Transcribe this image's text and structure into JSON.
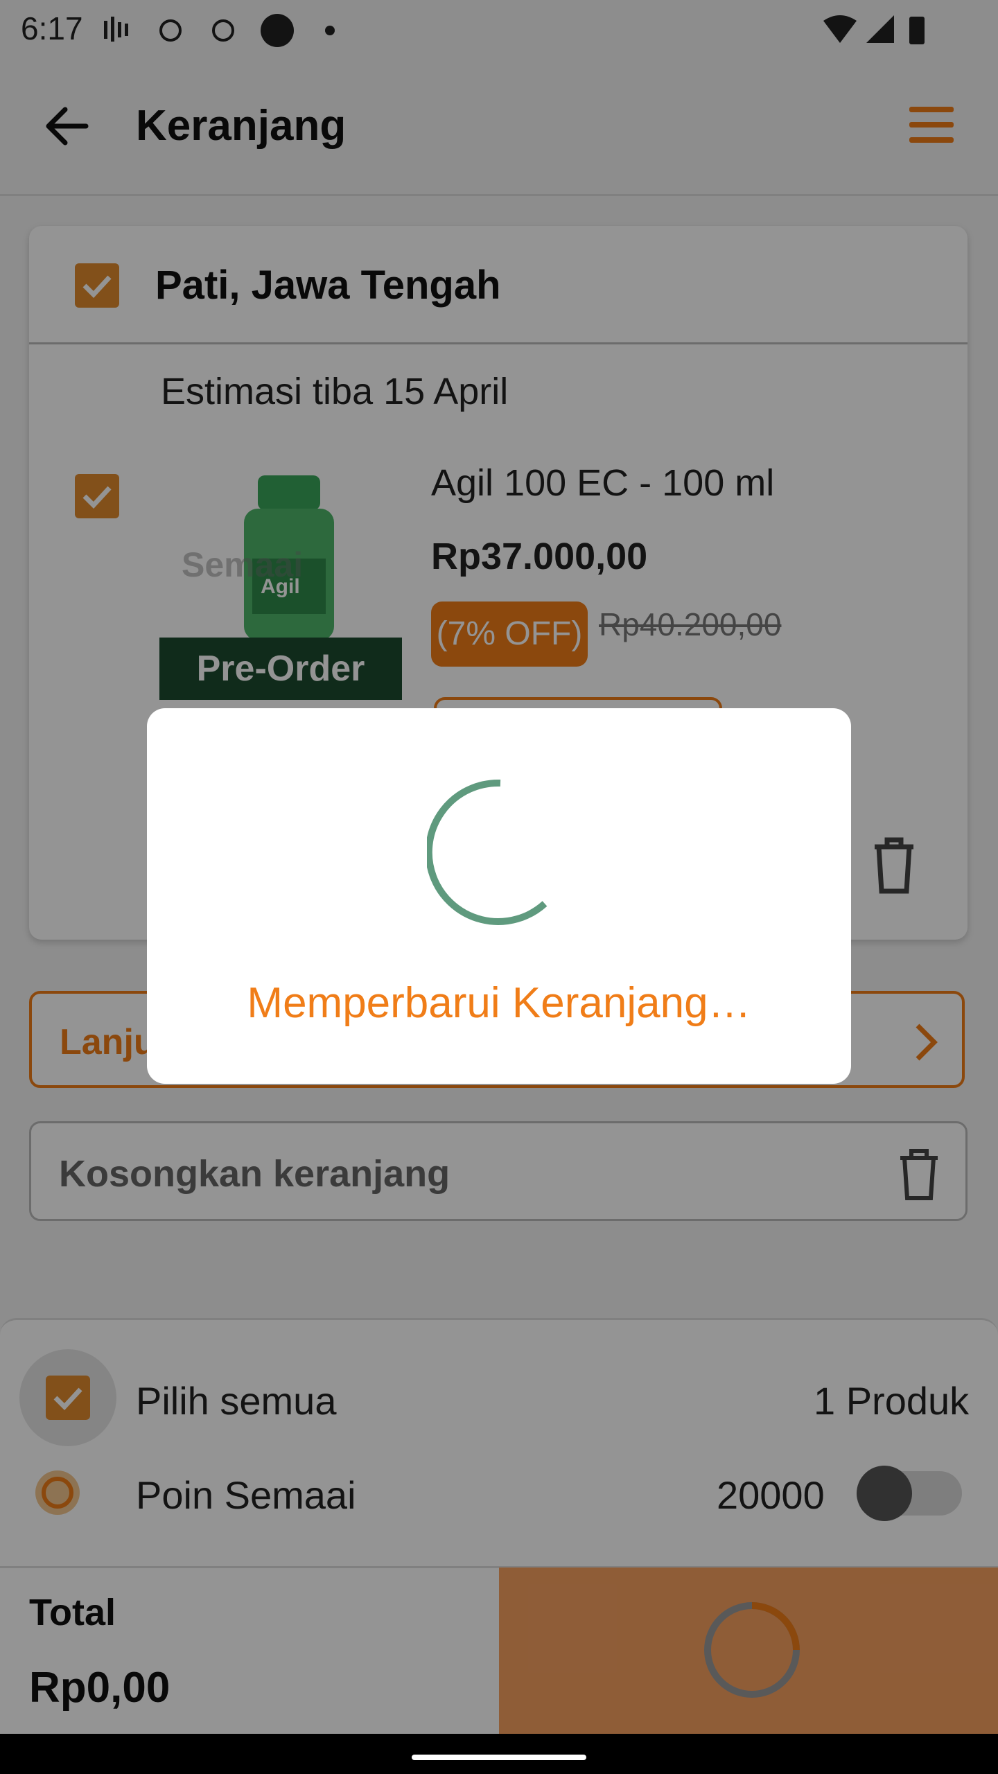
{
  "status_bar": {
    "time": "6:17"
  },
  "app_bar": {
    "title": "Keranjang",
    "back_icon": "arrow-left-icon",
    "menu_icon": "hamburger-menu-icon"
  },
  "store": {
    "name": "Pati, Jawa Tengah",
    "estimate": "Estimasi tiba 15 April",
    "product": {
      "name": "Agil 100 EC - 100 ml",
      "price": "Rp37.000,00",
      "discount": "(7% OFF)",
      "original_price": "Rp40.200,00",
      "badge": "Pre-Order",
      "watermark": "Semaai",
      "bottle_label": "Agil"
    }
  },
  "buttons": {
    "continue_label": "Lanju",
    "empty_cart_label": "Kosongkan keranjang"
  },
  "summary": {
    "select_all_label": "Pilih semua",
    "product_count": "1 Produk",
    "points_label": "Poin Semaai",
    "points_value": "20000",
    "total_label": "Total",
    "total_value": "Rp0,00"
  },
  "dialog": {
    "message": "Memperbarui Keranjang…"
  },
  "colors": {
    "accent": "#f07d18",
    "checkbox": "#e08a2e",
    "spinner": "#5f9a7e",
    "preorder_badge": "#1d4a2f"
  }
}
